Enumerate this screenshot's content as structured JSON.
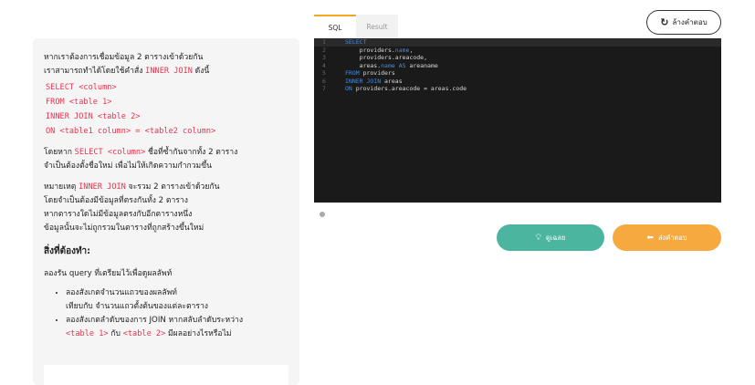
{
  "toolbar": {
    "reset_label": "ล้างคำตอบ",
    "reset_icon": "refresh-icon"
  },
  "tabs": [
    {
      "label": "SQL"
    },
    {
      "label": "Result"
    }
  ],
  "editor": {
    "lines": [
      {
        "num": "1",
        "text": "SELECT"
      },
      {
        "num": "2",
        "text": "    providers.name,"
      },
      {
        "num": "3",
        "text": "    providers.areacode,"
      },
      {
        "num": "4",
        "text": "    areas.name AS areaname"
      },
      {
        "num": "5",
        "text": "FROM providers"
      },
      {
        "num": "6",
        "text": "INNER JOIN areas"
      },
      {
        "num": "7",
        "text": "ON providers.areacode = areas.code"
      }
    ]
  },
  "actions": {
    "answer_label": "ดูเฉลย",
    "answer_icon": "lightbulb-icon",
    "submit_label": "ส่งคำตอบ",
    "submit_icon": "reply-arrow-icon"
  },
  "lesson": {
    "p1_a": "หากเราต้องการเชื่อมข้อมูล 2 ตารางเข้าด้วยกัน",
    "p1_b": "เราสามารถทำได้โดยใช้คำสั่ง ",
    "p1_code": "INNER JOIN",
    "p1_c": " ดังนี้",
    "syntax": [
      "SELECT <column>",
      "FROM <table 1>",
      "INNER JOIN <table 2>",
      "ON <table1 column> = <table2 column>"
    ],
    "p2_a": "โดยหาก ",
    "p2_code": "SELECT <column>",
    "p2_b": " ชื่อที่ซ้ำกันจากทั้ง 2 ตาราง",
    "p2_c": "จำเป็นต้องตั้งชื่อใหม่ เพื่อไม่ให้เกิดความกำกวมขึ้น",
    "note_a": "หมายเหตุ ",
    "note_code": "INNER JOIN",
    "note_b": " จะรวม 2 ตารางเข้าด้วยกัน",
    "note_c": "โดยจำเป็นต้องมีข้อมูลที่ตรงกันทั้ง 2 ตาราง",
    "note_d": "หากตารางใดไม่มีข้อมูลตรงกับอีกตารางหนึ่ง",
    "note_e": "ข้อมูลนั้นจะไม่ถูกรวมในตารางที่ถูกสร้างขึ้นใหม่",
    "todo_heading": "สิ่งที่ต้องทำ:",
    "todo_intro": "ลองรัน query ที่เตรียมไว้เพื่อดูผลลัพท์",
    "bullet1_a": "ลองสังเกตจำนวนแถวของผลลัพท์",
    "bullet1_b": "เทียบกับ จำนวนแถวตั้งต้นของแต่ละตาราง",
    "bullet2_a": "ลองสังเกตลำดับของการ JOIN หากสลับลำดับระหว่าง",
    "bullet2_code1": "<table 1>",
    "bullet2_mid": " กับ ",
    "bullet2_code2": "<table 2>",
    "bullet2_end": " มีผลอย่างไรหรือไม่"
  }
}
